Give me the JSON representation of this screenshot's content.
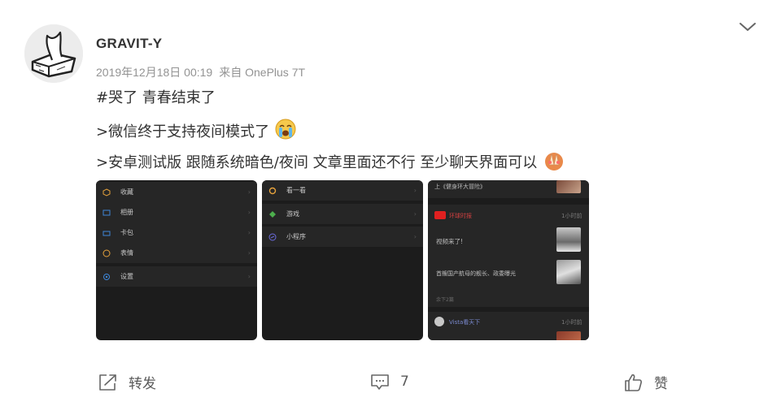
{
  "post": {
    "username": "GRAVIT-Y",
    "timestamp": "2019年12月18日 00:19",
    "source": "来自 OnePlus 7T",
    "lines": [
      "#哭了 青春结束了",
      ">微信终于支持夜间模式了",
      ">安卓测试版 跟随系统暗色/夜间 文章里面还不行 至少聊天界面可以"
    ],
    "emojis": [
      "crying-face-emoji",
      "clapping-hands-emoji"
    ]
  },
  "screenshots": {
    "shot1": {
      "items": [
        {
          "label": "收藏",
          "icon": "cube-icon",
          "color": "#e6a23c"
        },
        {
          "label": "相册",
          "icon": "photo-icon",
          "color": "#3d86d8"
        },
        {
          "label": "卡包",
          "icon": "card-icon",
          "color": "#3d86d8"
        },
        {
          "label": "表情",
          "icon": "smile-icon",
          "color": "#e6a23c"
        },
        {
          "label": "设置",
          "icon": "gear-icon",
          "color": "#3d86d8"
        }
      ]
    },
    "shot2": {
      "items": [
        {
          "label": "看一看",
          "icon": "look-icon",
          "color": "#e6a23c"
        },
        {
          "label": "游戏",
          "icon": "game-icon",
          "color": "#4cae4c"
        },
        {
          "label": "小程序",
          "icon": "miniprogram-icon",
          "color": "#6b6bdc"
        }
      ]
    },
    "shot3": {
      "top_title": "上《健身环大冒险》",
      "account1": {
        "name": "环球时报",
        "time": "1小时前"
      },
      "article1": "视频来了!",
      "article2": "首艘国产航母的舰长、政委曝光",
      "more1": "余下2篇",
      "account2": {
        "name": "Vista看天下",
        "time": "1小时前"
      }
    }
  },
  "actions": {
    "repost": "转发",
    "comment_count": "7",
    "like": "赞"
  },
  "colors": {
    "text": "#333333",
    "meta": "#939393",
    "dark_bg": "#1c1c1c",
    "row_bg": "#262626"
  }
}
